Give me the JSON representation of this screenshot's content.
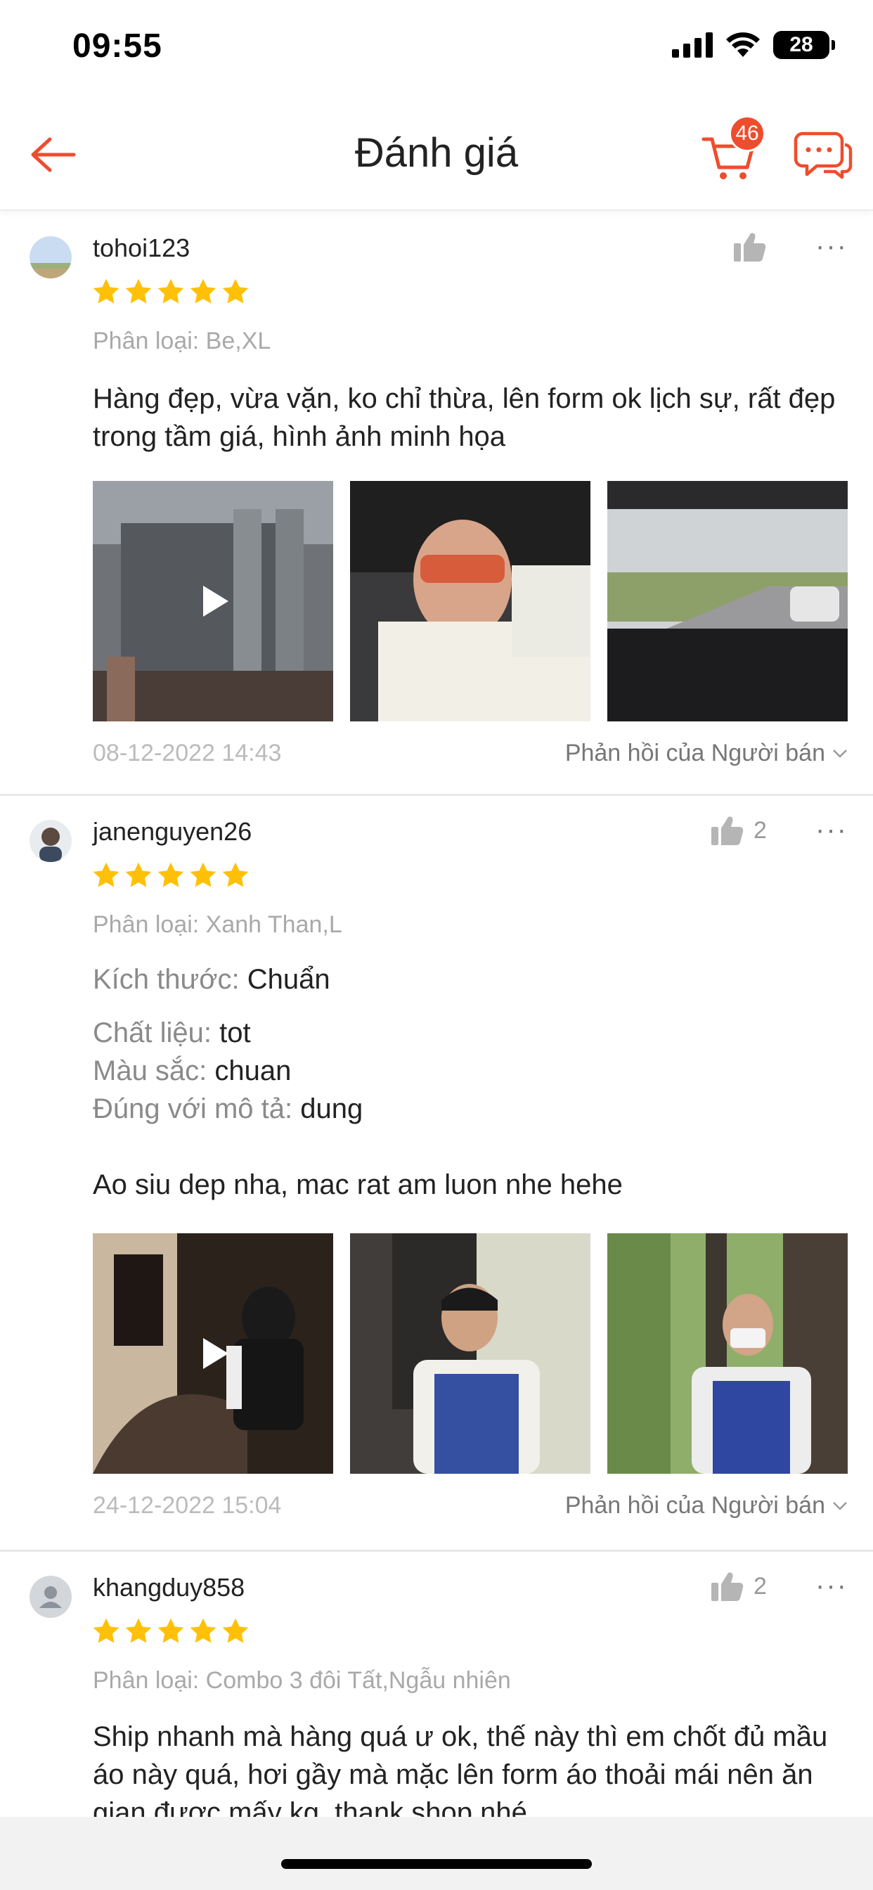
{
  "status_bar": {
    "time": "09:55",
    "battery": "28"
  },
  "header": {
    "title": "Đánh giá",
    "cart_count": "46"
  },
  "colors": {
    "accent": "#ee4d2d",
    "star": "#ffc107"
  },
  "reviews": [
    {
      "username": "tohoi123",
      "rating": 5,
      "likes": "",
      "variant": "Phân loại: Be,XL",
      "text": "Hàng đẹp, vừa vặn, ko chỉ thừa, lên form ok lịch sự, rất đẹp trong tầm giá, hình ảnh minh họa",
      "date": "08-12-2022 14:43",
      "seller_reply": "Phản hồi của Người bán"
    },
    {
      "username": "janenguyen26",
      "rating": 5,
      "likes": "2",
      "variant": "Phân loại: Xanh Than,L",
      "attributes": [
        {
          "label": "Kích thước:",
          "value": "Chuẩn"
        },
        {
          "label": "Chất liệu:",
          "value": "tot"
        },
        {
          "label": "Màu sắc:",
          "value": "chuan"
        },
        {
          "label": "Đúng với mô tả:",
          "value": "dung"
        }
      ],
      "text": "Ao siu dep nha, mac rat am luon nhe hehe",
      "date": "24-12-2022 15:04",
      "seller_reply": "Phản hồi của Người bán"
    },
    {
      "username": "khangduy858",
      "rating": 5,
      "likes": "2",
      "variant": "Phân loại: Combo 3 đôi Tất,Ngẫu nhiên",
      "text": "Ship nhanh mà hàng quá ư ok, thế này thì em chốt đủ mầu áo này quá, hơi gầy mà mặc lên form áo thoải mái nên ăn gian được mấy kg, thank shop nhé"
    }
  ]
}
